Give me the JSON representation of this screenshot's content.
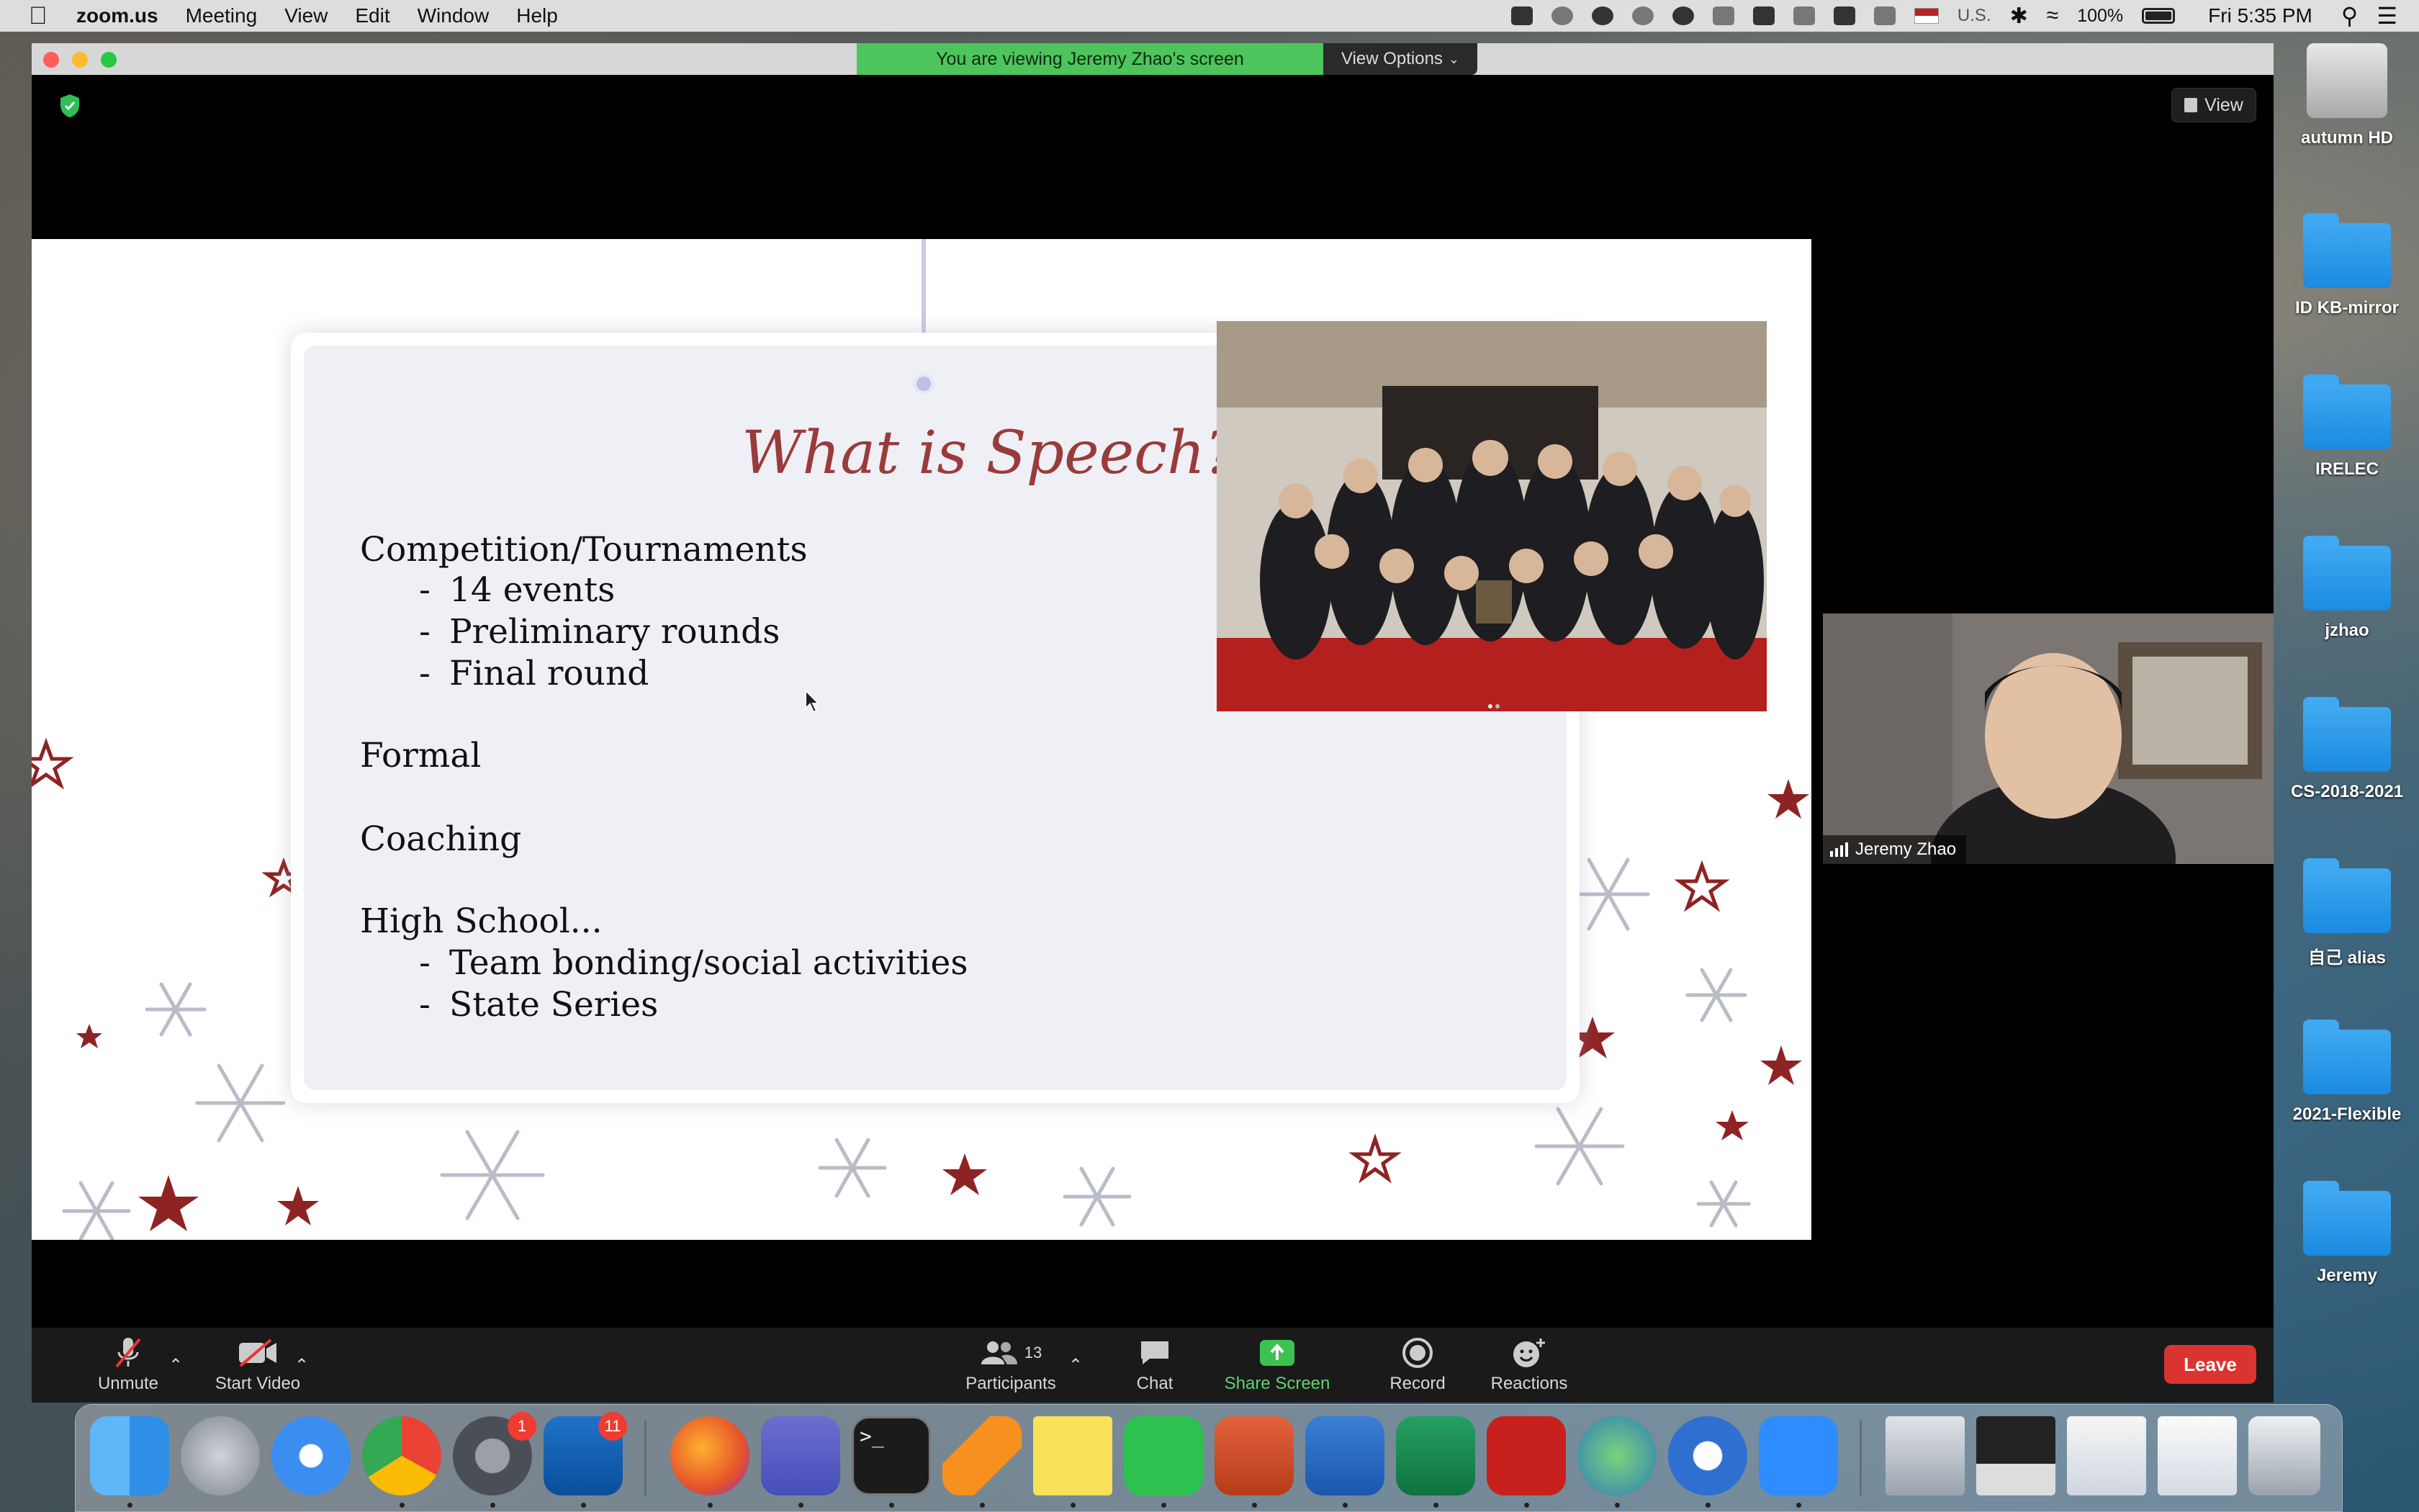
{
  "menubar": {
    "app_name": "zoom.us",
    "menus": [
      "Meeting",
      "View",
      "Edit",
      "Window",
      "Help"
    ],
    "input_source": "U.S.",
    "battery": "100%",
    "clock": "Fri 5:35 PM"
  },
  "zoom": {
    "banner": "You are viewing Jeremy Zhao's screen",
    "view_options": "View Options",
    "view_button": "View",
    "participant_name": "Jeremy Zhao",
    "toolbar": {
      "unmute": "Unmute",
      "start_video": "Start Video",
      "participants": "Participants",
      "participant_count": "13",
      "chat": "Chat",
      "share_screen": "Share Screen",
      "record": "Record",
      "reactions": "Reactions",
      "leave": "Leave"
    },
    "colors": {
      "share_green": "#5fd36c",
      "leave_red": "#d9342f",
      "banner_green": "#4ec45c"
    }
  },
  "slide": {
    "title": "What is Speech?",
    "lines": [
      "Competition/Tournaments",
      "14 events",
      "Preliminary rounds",
      "Final round",
      "Formal",
      "Coaching",
      "High School...",
      "Team bonding/social activities",
      "State Series"
    ],
    "dash": "-"
  },
  "desktop": {
    "icons": [
      "autumn HD",
      "ID KB-mirror",
      "IRELEC",
      "jzhao",
      "CS-2018-2021",
      "自己 alias",
      "2021-Flexible",
      "Jeremy"
    ]
  },
  "dock": {
    "mail_badge": "1",
    "outlook_badge": "11",
    "apps": [
      "Finder",
      "Launchpad",
      "Safari",
      "Chrome",
      "System Preferences",
      "Outlook",
      "Firefox",
      "Teams",
      "Terminal",
      "VLC",
      "Stickies",
      "WeChat",
      "PowerPoint",
      "Word",
      "Excel",
      "Acrobat",
      "Synergy",
      "Citrix",
      "Zoom"
    ],
    "terminal_prompt": ">_"
  }
}
